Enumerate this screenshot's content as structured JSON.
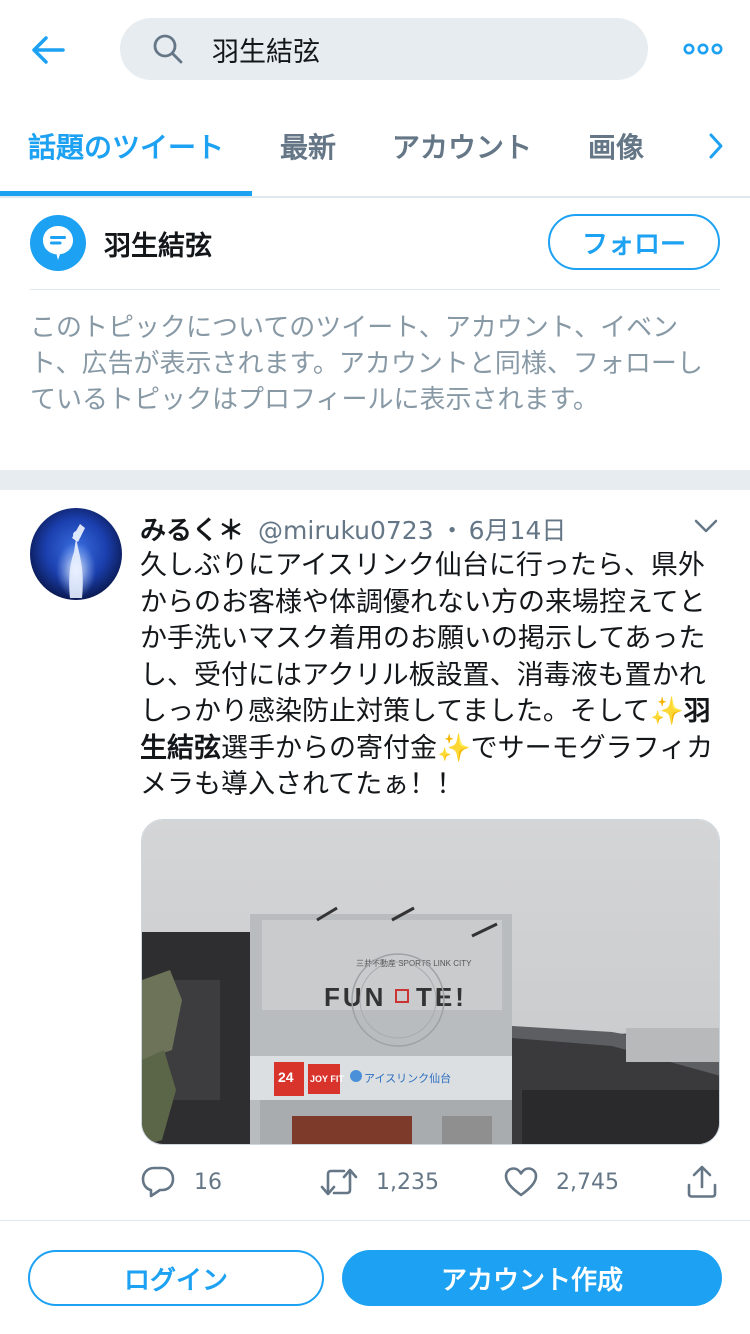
{
  "search": {
    "query": "羽生結弦"
  },
  "tabs": [
    {
      "label": "話題のツイート",
      "active": true
    },
    {
      "label": "最新",
      "active": false
    },
    {
      "label": "アカウント",
      "active": false
    },
    {
      "label": "画像",
      "active": false
    }
  ],
  "topic": {
    "name": "羽生結弦",
    "follow_label": "フォロー",
    "description": "このトピックについてのツイート、アカウント、イベント、広告が表示されます。アカウントと同様、フォローしているトピックはプロフィールに表示されます。"
  },
  "tweet": {
    "display_name": "みるく＊",
    "handle": "@miruku0723",
    "separator": "・",
    "date": "6月14日",
    "text_part1": "久しぶりにアイスリンク仙台に行ったら、県外からのお客様や体調優れない方の来場控えてとか手洗いマスク着用のお願いの掲示してあったし、受付にはアクリル板設置、消毒液も置かれしっかり感染防止対策してました。そして",
    "sparkle": "✨",
    "highlight": "羽生結弦",
    "text_part2": "選手からの寄付金",
    "text_part3": "でサーモグラフィカメラも導入されてたぁ！！",
    "image": {
      "sign_small": "三井不動産 SPORTS LINK CITY",
      "sign_main_left": "FUN",
      "sign_main_right": "TE!",
      "banner_24": "24",
      "banner_joyfit": "JOY FIT",
      "banner_rink": "アイスリンク仙台"
    },
    "replies": "16",
    "retweets": "1,235",
    "likes": "2,745"
  },
  "footer": {
    "login_label": "ログイン",
    "signup_label": "アカウント作成"
  },
  "colors": {
    "accent": "#1da1f2",
    "muted": "#657786",
    "separator": "#e6ecf0"
  },
  "icons": [
    "back-arrow-icon",
    "search-icon",
    "more-icon",
    "chevron-right-icon",
    "topic-bubble-icon",
    "caret-down-icon",
    "reply-icon",
    "retweet-icon",
    "like-icon",
    "share-icon"
  ]
}
